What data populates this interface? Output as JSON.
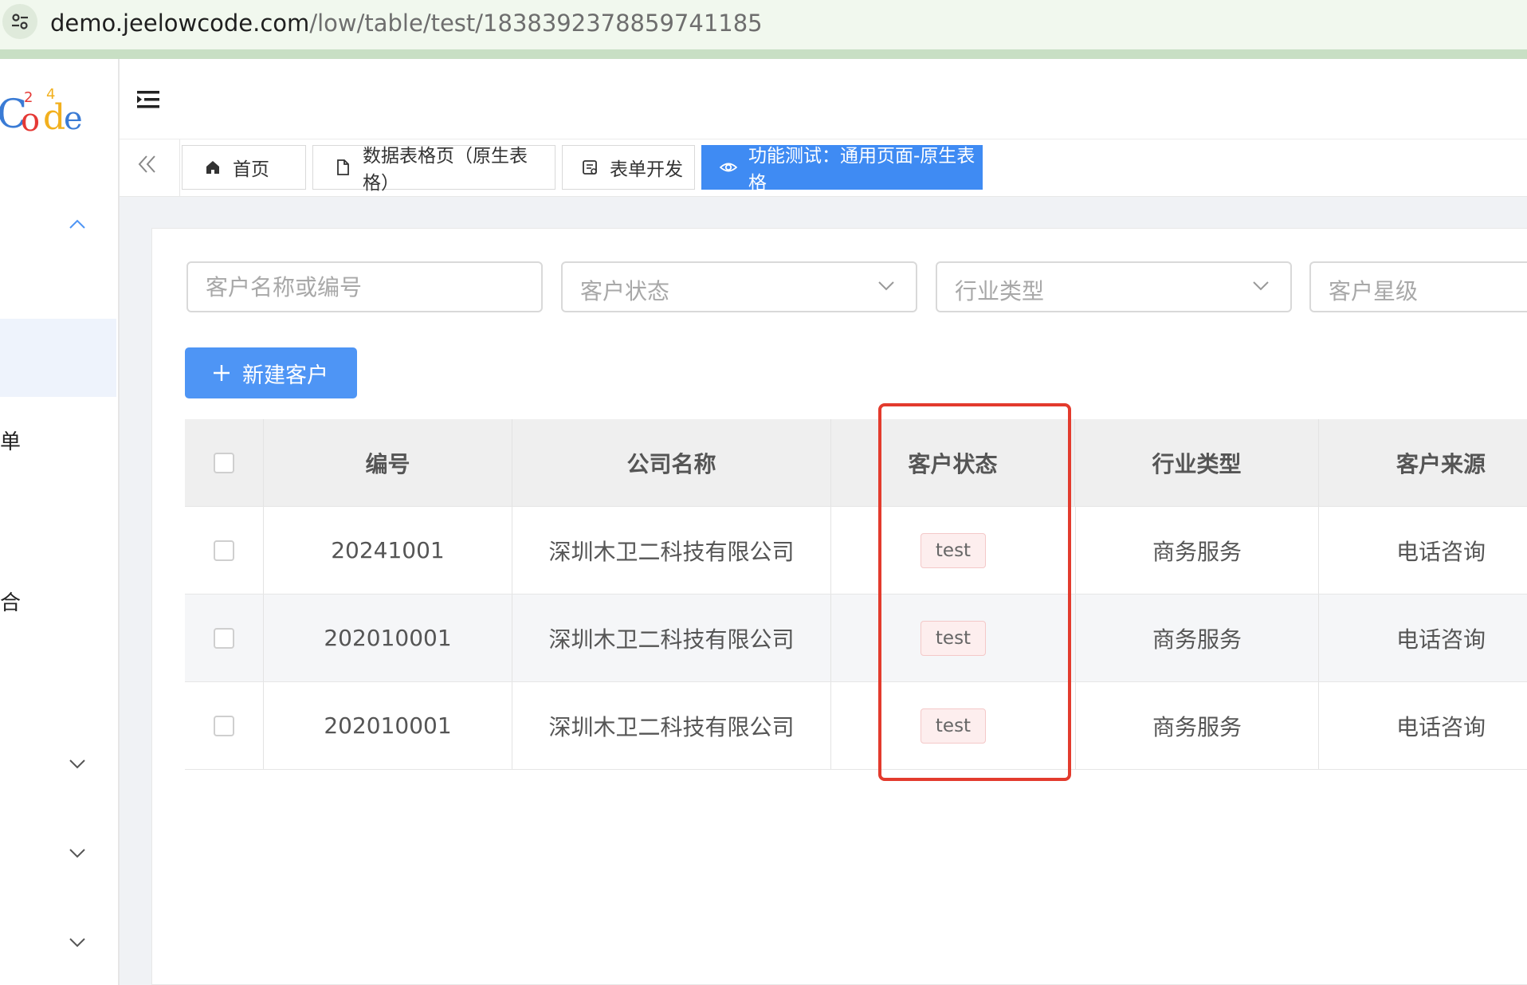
{
  "browser": {
    "url_host": "demo.jeelowcode.com",
    "url_path": "/low/table/test/1838392378859741185",
    "site_icon": "tune-icon"
  },
  "sidebar": {
    "logo_text": "Code",
    "visible_texts": [
      "单",
      "合"
    ]
  },
  "tabs": [
    {
      "label": "首页",
      "icon": "home-icon",
      "active": false
    },
    {
      "label": "数据表格页（原生表格）",
      "icon": "document-icon",
      "active": false
    },
    {
      "label": "表单开发",
      "icon": "form-icon",
      "active": false
    },
    {
      "label": "功能测试：通用页面-原生表格",
      "icon": "eye-icon",
      "active": true
    }
  ],
  "filters": {
    "name_placeholder": "客户名称或编号",
    "status_placeholder": "客户状态",
    "industry_placeholder": "行业类型",
    "star_placeholder": "客户星级"
  },
  "toolbar": {
    "new_button_label": "新建客户"
  },
  "table": {
    "columns": [
      "编号",
      "公司名称",
      "客户状态",
      "行业类型",
      "客户来源"
    ],
    "rows": [
      {
        "id": "20241001",
        "company": "深圳木卫二科技有限公司",
        "status": "test",
        "industry": "商务服务",
        "source": "电话咨询"
      },
      {
        "id": "202010001",
        "company": "深圳木卫二科技有限公司",
        "status": "test",
        "industry": "商务服务",
        "source": "电话咨询"
      },
      {
        "id": "202010001",
        "company": "深圳木卫二科技有限公司",
        "status": "test",
        "industry": "商务服务",
        "source": "电话咨询"
      }
    ]
  },
  "colors": {
    "accent": "#3f8bf3",
    "button": "#4e95f5",
    "highlight_box": "#e33b2d",
    "tag_bg": "#fdeeee",
    "tag_border": "#f4c8c8"
  }
}
